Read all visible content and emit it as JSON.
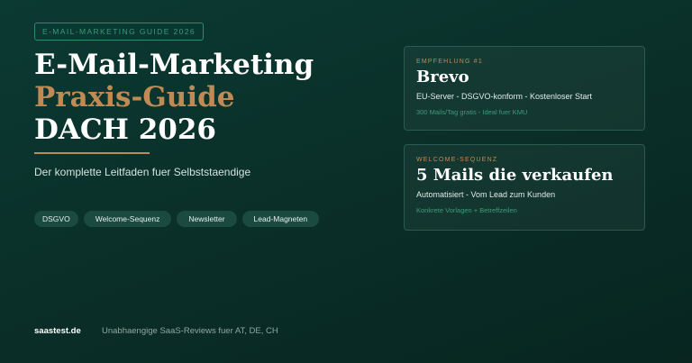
{
  "badge": "E-MAIL-MARKETING GUIDE 2026",
  "hero": {
    "title_line1": "E-Mail-Marketing",
    "title_line2": "Praxis-Guide",
    "title_line3": "DACH 2026",
    "subtitle": "Der komplette Leitfaden fuer Selbststaendige"
  },
  "tags": [
    "DSGVO",
    "Welcome-Sequenz",
    "Newsletter",
    "Lead-Magneten"
  ],
  "cards": [
    {
      "label": "EMPFEHLUNG #1",
      "title": "Brevo",
      "description": "EU-Server - DSGVO-konform - Kostenloser Start",
      "note": "300 Mails/Tag gratis - Ideal fuer KMU"
    },
    {
      "label": "WELCOME-SEQUENZ",
      "title": "5 Mails die verkaufen",
      "description": "Automatisiert - Vom Lead zum Kunden",
      "note": "Konkrete Vorlagen + Betreffzeilen"
    }
  ],
  "footer": {
    "brand": "saastest.de",
    "tagline": "Unabhaengige SaaS-Reviews fuer AT, DE, CH"
  },
  "colors": {
    "background": "#0a3029",
    "accent": "#c08a55",
    "green_accent": "#3e9b7a",
    "tag_bg": "#1a4a40"
  }
}
